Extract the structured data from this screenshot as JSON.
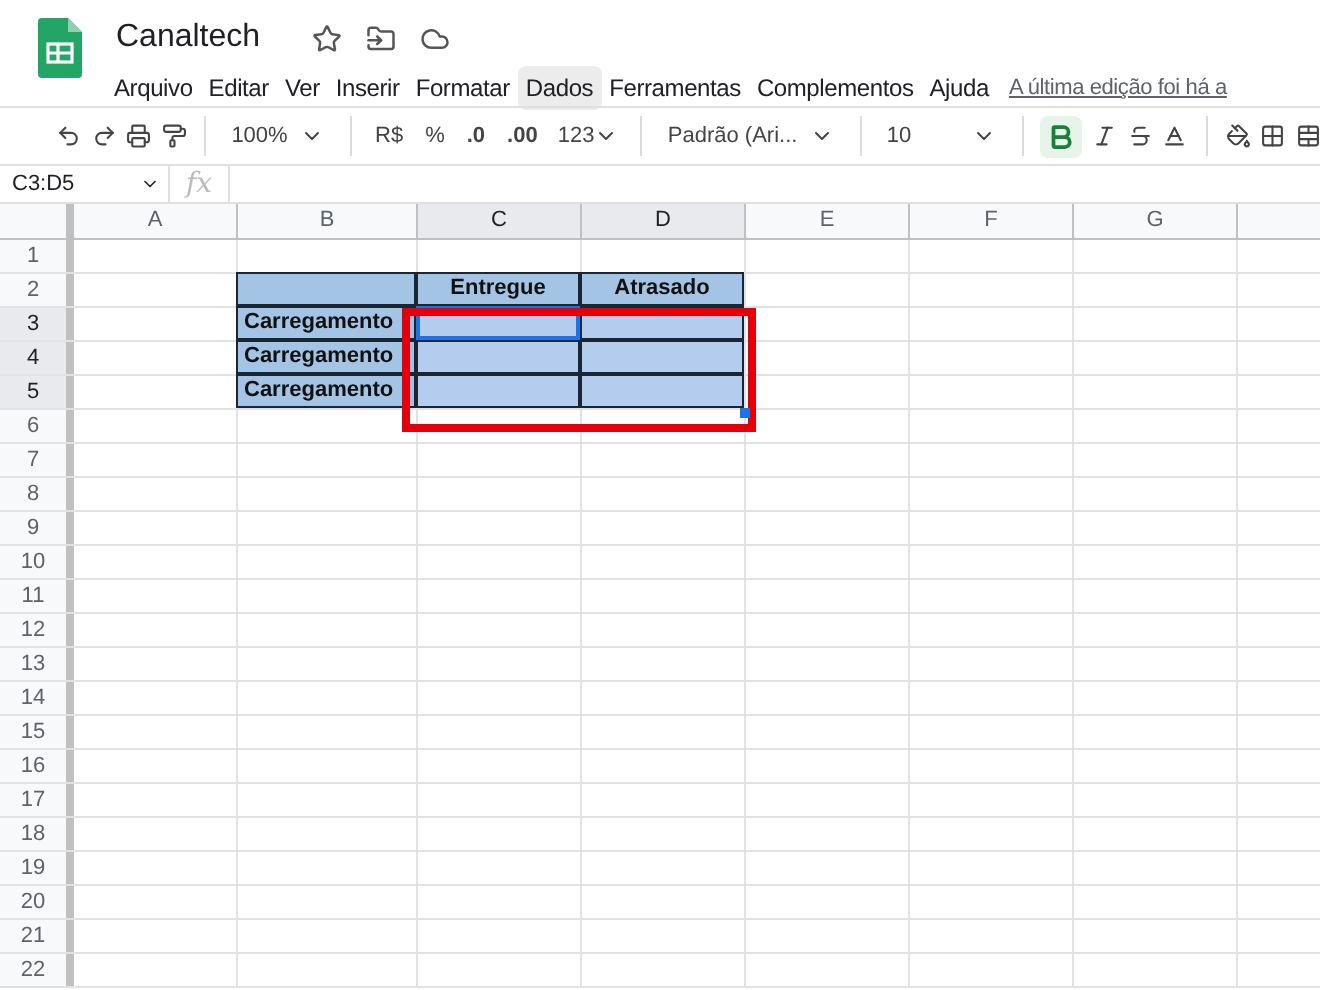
{
  "app": {
    "title": "Canaltech"
  },
  "menu": [
    {
      "label": "Arquivo",
      "selected": false
    },
    {
      "label": "Editar",
      "selected": false
    },
    {
      "label": "Ver",
      "selected": false
    },
    {
      "label": "Inserir",
      "selected": false
    },
    {
      "label": "Formatar",
      "selected": false
    },
    {
      "label": "Dados",
      "selected": true
    },
    {
      "label": "Ferramentas",
      "selected": false
    },
    {
      "label": "Complementos",
      "selected": false
    },
    {
      "label": "Ajuda",
      "selected": false
    }
  ],
  "last_edit": "A última edição foi há a",
  "toolbar": {
    "zoom": "100%",
    "currency": "R$",
    "percent": "%",
    "decrease_decimals": ".0",
    "increase_decimals": ".00",
    "number_format": "123",
    "font": "Padrão (Ari...",
    "font_size": "10",
    "bold": true
  },
  "name_box": "C3:D5",
  "formula_label": "fx",
  "columns": [
    {
      "label": "A",
      "selected": false
    },
    {
      "label": "B",
      "selected": false
    },
    {
      "label": "C",
      "selected": true
    },
    {
      "label": "D",
      "selected": true
    },
    {
      "label": "E",
      "selected": false
    },
    {
      "label": "F",
      "selected": false
    },
    {
      "label": "G",
      "selected": false
    }
  ],
  "rows": [
    {
      "label": "1",
      "selected": false
    },
    {
      "label": "2",
      "selected": false
    },
    {
      "label": "3",
      "selected": true
    },
    {
      "label": "4",
      "selected": true
    },
    {
      "label": "5",
      "selected": true
    },
    {
      "label": "6",
      "selected": false
    },
    {
      "label": "7",
      "selected": false
    },
    {
      "label": "8",
      "selected": false
    },
    {
      "label": "9",
      "selected": false
    },
    {
      "label": "10",
      "selected": false
    },
    {
      "label": "11",
      "selected": false
    },
    {
      "label": "12",
      "selected": false
    },
    {
      "label": "13",
      "selected": false
    },
    {
      "label": "14",
      "selected": false
    },
    {
      "label": "15",
      "selected": false
    },
    {
      "label": "16",
      "selected": false
    },
    {
      "label": "17",
      "selected": false
    },
    {
      "label": "18",
      "selected": false
    },
    {
      "label": "19",
      "selected": false
    },
    {
      "label": "20",
      "selected": false
    },
    {
      "label": "21",
      "selected": false
    },
    {
      "label": "22",
      "selected": false
    }
  ],
  "data_table": {
    "header": [
      "Entregue",
      "Atrasado"
    ],
    "rows": [
      {
        "label": "Carregamento"
      },
      {
        "label": "Carregamento"
      },
      {
        "label": "Carregamento"
      }
    ]
  }
}
